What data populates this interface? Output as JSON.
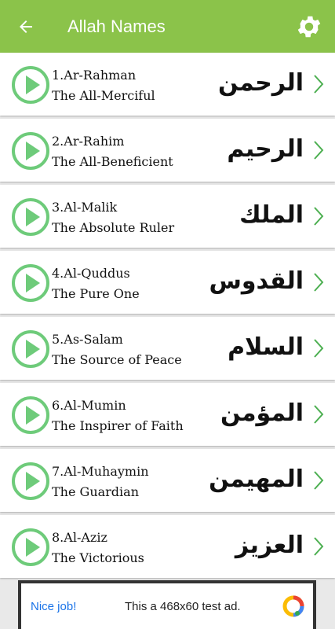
{
  "app_bar": {
    "title": "Allah Names",
    "back_icon": "arrow-left-icon",
    "settings_icon": "gear-icon"
  },
  "colors": {
    "primary": "#8bc34a",
    "play": "#6ecb7a",
    "chevron": "#4caf50"
  },
  "items": [
    {
      "name": "1.Ar-Rahman",
      "meaning": "The All-Merciful",
      "arabic": "الرحمن"
    },
    {
      "name": "2.Ar-Rahim",
      "meaning": "The All-Beneficient",
      "arabic": "الرحيم"
    },
    {
      "name": "3.Al-Malik",
      "meaning": "The Absolute Ruler",
      "arabic": "الملك"
    },
    {
      "name": "4.Al-Quddus",
      "meaning": "The Pure One",
      "arabic": "القدوس"
    },
    {
      "name": "5.As-Salam",
      "meaning": "The Source of Peace",
      "arabic": "السلام"
    },
    {
      "name": "6.Al-Mumin",
      "meaning": "The Inspirer of Faith",
      "arabic": "المؤمن"
    },
    {
      "name": "7.Al-Muhaymin",
      "meaning": "The Guardian",
      "arabic": "المهيمن"
    },
    {
      "name": "8.Al-Aziz",
      "meaning": "The Victorious",
      "arabic": "العزيز"
    }
  ],
  "ad": {
    "title": "Nice job!",
    "text": "This a 468x60 test ad."
  }
}
